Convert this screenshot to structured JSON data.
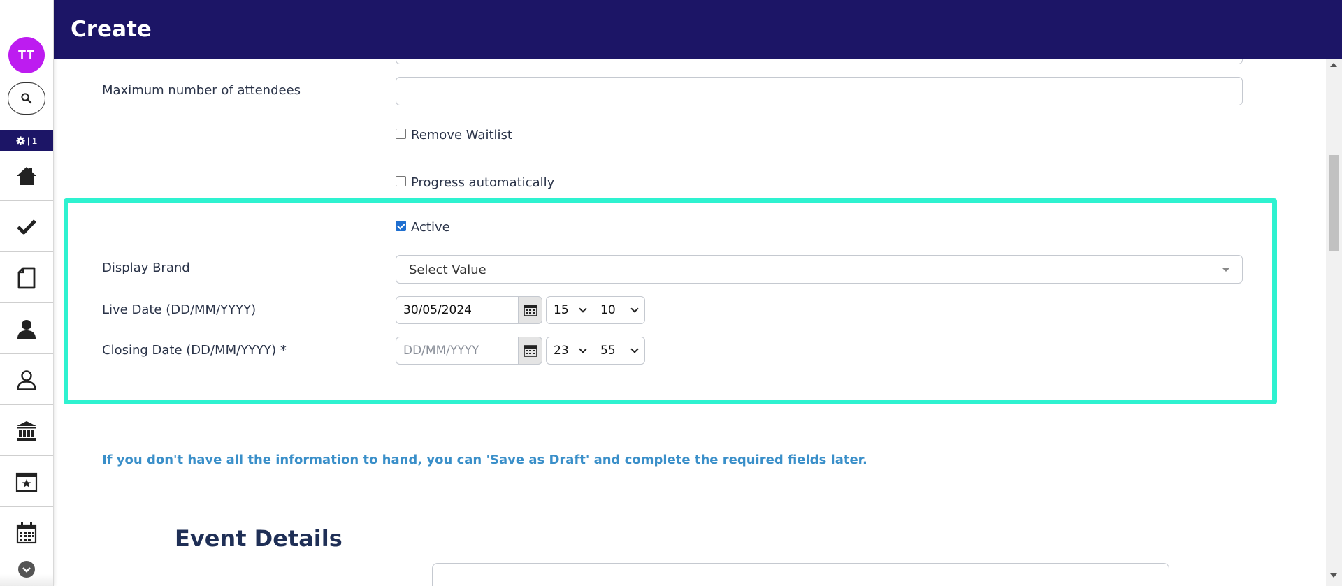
{
  "header": {
    "title": "Create"
  },
  "sidebar": {
    "avatar_initials": "TT",
    "settings_label": "| 1",
    "items": [
      {
        "icon": "home-icon"
      },
      {
        "icon": "checkmark-icon"
      },
      {
        "icon": "document-icon"
      },
      {
        "icon": "person-icon"
      },
      {
        "icon": "person-outline-icon"
      },
      {
        "icon": "bank-icon"
      },
      {
        "icon": "calendar-star-icon"
      },
      {
        "icon": "calendar-icon"
      }
    ]
  },
  "form": {
    "max_attendees": {
      "label": "Maximum number of attendees",
      "value": ""
    },
    "remove_waitlist": {
      "label": "Remove Waitlist",
      "checked": false
    },
    "progress_auto": {
      "label": "Progress automatically",
      "checked": false
    },
    "active": {
      "label": "Active",
      "checked": true
    },
    "display_brand": {
      "label": "Display Brand",
      "value": "Select Value"
    },
    "live_date": {
      "label": "Live Date (DD/MM/YYYY)",
      "date": "30/05/2024",
      "hour": "15",
      "minute": "10"
    },
    "closing_date": {
      "label": "Closing Date (DD/MM/YYYY) *",
      "placeholder": "DD/MM/YYYY",
      "hour": "23",
      "minute": "55"
    }
  },
  "draft_note": "If you don't have all the information to hand, you can 'Save as Draft' and complete the required fields later.",
  "section_title": "Event Details",
  "colors": {
    "header_bg": "#1c1566",
    "avatar_bg": "#bd1cf0",
    "highlight": "#2ef2d0",
    "note_text": "#3a8fc9"
  }
}
